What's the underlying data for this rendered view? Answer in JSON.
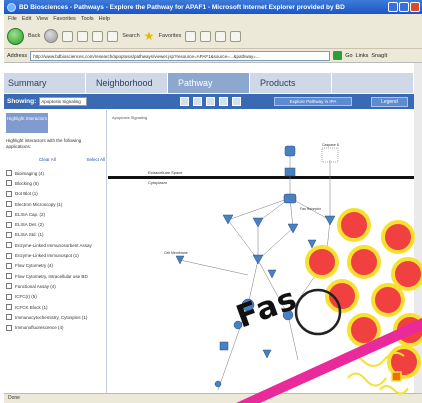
{
  "window": {
    "title": "BD Biosciences - Pathways - Explore the Pathway for APAF1 - Microsoft Internet Explorer provided by BD"
  },
  "menu": {
    "items": [
      "File",
      "Edit",
      "View",
      "Favorites",
      "Tools",
      "Help"
    ]
  },
  "toolbar": {
    "back_label": "Back",
    "search_label": "Search",
    "favorites_label": "Favorites"
  },
  "address": {
    "label": "Address",
    "value": "http://www.bdbiosciences.com/research/apoptosis/pathways/viewer.jsp?resource=APAF1&source=...&pathway=...",
    "go_label": "Go",
    "links_label": "Links",
    "snagit_label": "SnagIt"
  },
  "tabs": [
    {
      "label": "Summary",
      "active": false
    },
    {
      "label": "Neighborhood",
      "active": false
    },
    {
      "label": "Pathway",
      "active": true
    },
    {
      "label": "Products",
      "active": false
    }
  ],
  "showbar": {
    "label": "Showing:",
    "select_value": "Apoptosis Signaling",
    "explore_label": "Explore Pathway in IPA",
    "legend_label": "Legend"
  },
  "leftpanel": {
    "tab_label": "Highlight Interactors",
    "instructions": "Highlight interactors with the following applications:",
    "clear_all": "Clear All",
    "select_all": "Select All",
    "applications": [
      "Bioimaging (4)",
      "Blocking (5)",
      "Dot Blot (1)",
      "Electron Microscopy (1)",
      "ELISA Cap. (2)",
      "ELISA Det. (2)",
      "ELISA Std. (1)",
      "Enzyme-Linked Immunosorbent Assay",
      "Enzyme-Linked Immunospot (1)",
      "Flow Cytometry (4)",
      "Flow Cytometry, Intracellular use BD",
      "Functional Assay (4)",
      "ICFC(r) (5)",
      "ICFCK Block (1)",
      "Immunocytochemistry, Cytospins (1)",
      "Immunofluorescence (4)"
    ]
  },
  "pathway": {
    "title": "Apoptosis Signaling",
    "labels": {
      "cytoplasm": "Cytoplasm",
      "extracellular": "Extracellular Space",
      "mid_left": "Cell Membrane",
      "mid_right": "Fas Receptor",
      "top_right": "Caspase 8"
    }
  },
  "status": {
    "text": "Done"
  },
  "overlay": {
    "text": "Fas",
    "colors": {
      "circle_fill": "#f04040",
      "circle_ring": "#f6e030",
      "stripe": "#ea2a9a"
    }
  }
}
